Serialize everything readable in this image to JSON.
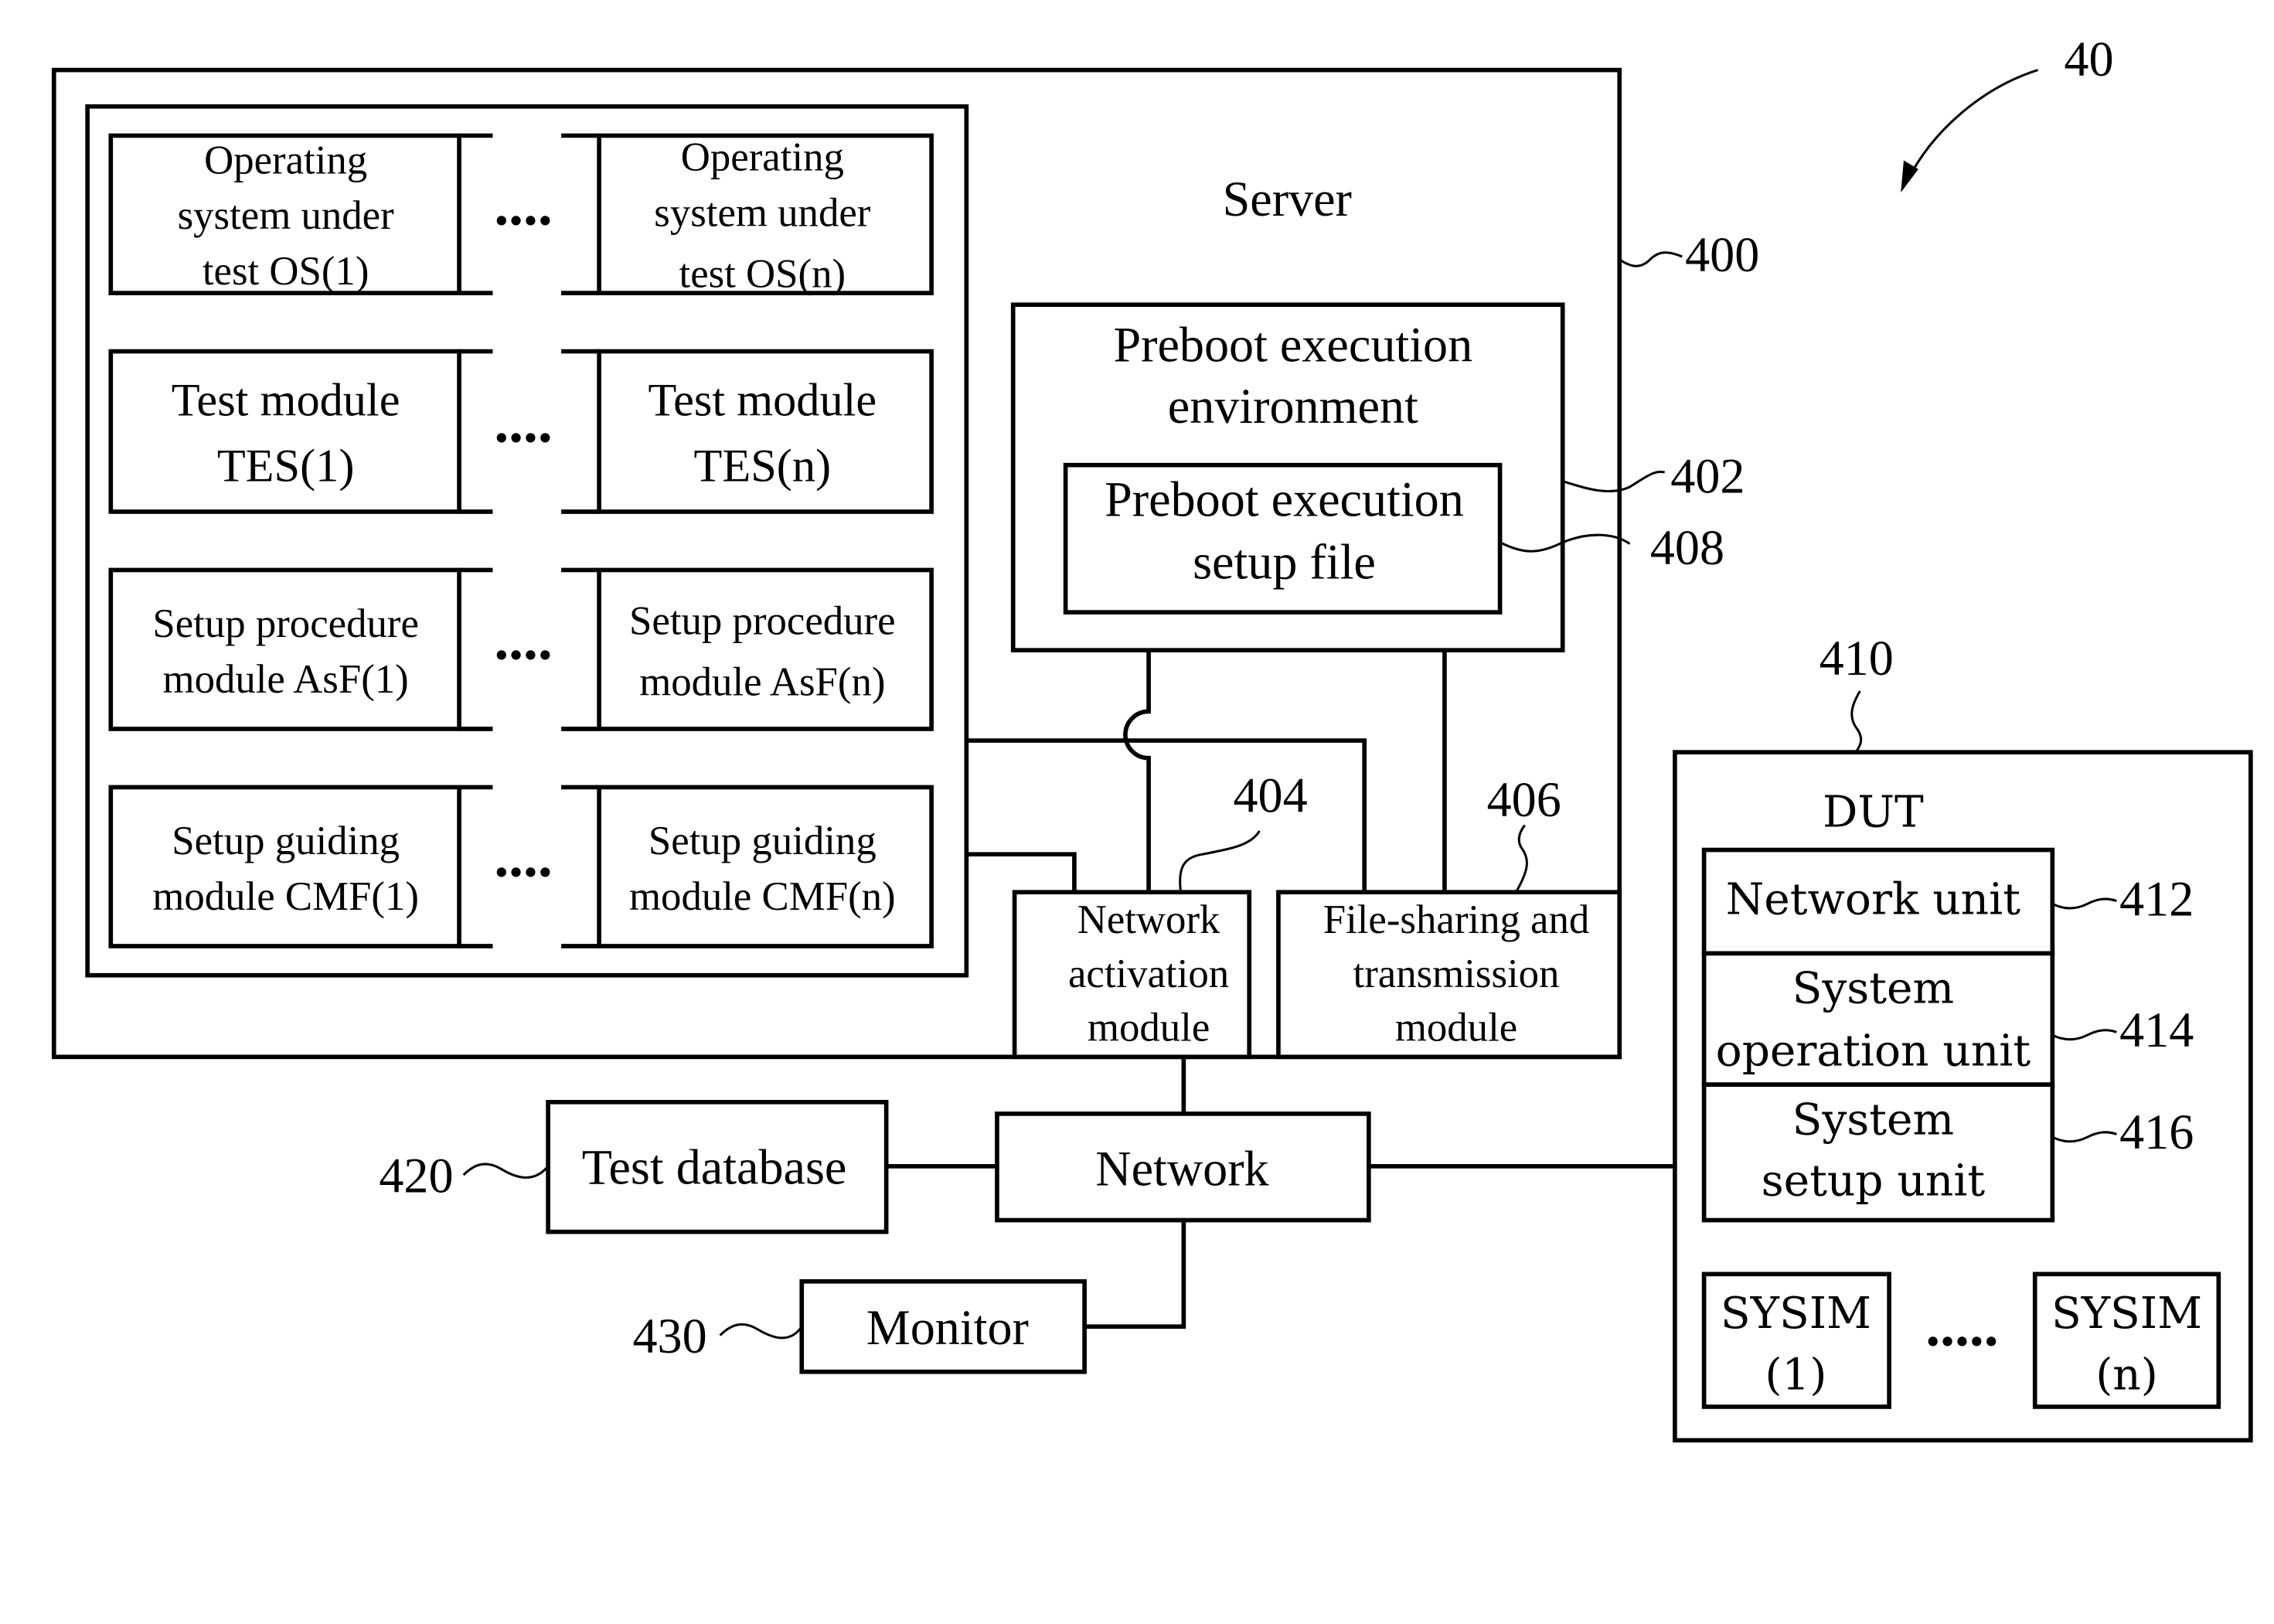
{
  "figure_ref": "40",
  "server": {
    "title": "Server",
    "ref": "400",
    "module_rows": [
      {
        "first": [
          "Operating",
          "system under",
          "test OS(1)"
        ],
        "last": [
          "Operating",
          "system under",
          "test OS(n)"
        ],
        "ellipsis": "...."
      },
      {
        "first": [
          "Test module",
          "TES(1)"
        ],
        "last": [
          "Test module",
          "TES(n)"
        ],
        "ellipsis": "...."
      },
      {
        "first": [
          "Setup procedure",
          "module AsF(1)"
        ],
        "last": [
          "Setup procedure",
          "module AsF(n)"
        ],
        "ellipsis": "...."
      },
      {
        "first": [
          "Setup guiding",
          "module CMF(1)"
        ],
        "last": [
          "Setup guiding",
          "module CMF(n)"
        ],
        "ellipsis": "...."
      }
    ],
    "pxe_env": {
      "lines": [
        "Preboot execution",
        "environment"
      ],
      "ref": "402"
    },
    "pxe_file": {
      "lines": [
        "Preboot execution",
        "setup file"
      ],
      "ref": "408"
    },
    "net_activation": {
      "lines": [
        "Network",
        "activation",
        "module"
      ],
      "ref": "404"
    },
    "file_sharing": {
      "lines": [
        "File-sharing and",
        "transmission",
        "module"
      ],
      "ref": "406"
    }
  },
  "network": {
    "label": "Network"
  },
  "test_database": {
    "label": "Test database",
    "ref": "420"
  },
  "monitor": {
    "label": "Monitor",
    "ref": "430"
  },
  "dut": {
    "title": "DUT",
    "ref": "410",
    "units": [
      {
        "lines": [
          "Network unit"
        ],
        "ref": "412"
      },
      {
        "lines": [
          "System",
          "operation unit"
        ],
        "ref": "414"
      },
      {
        "lines": [
          "System",
          "setup unit"
        ],
        "ref": "416"
      }
    ],
    "sysims": [
      {
        "lines": [
          "SYSIM",
          "(1)"
        ]
      },
      {
        "lines": [
          "SYSIM",
          "(n)"
        ]
      }
    ],
    "ellipsis": "....."
  }
}
